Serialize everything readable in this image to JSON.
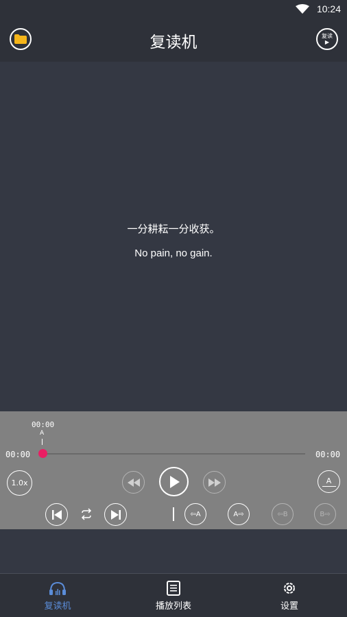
{
  "status": {
    "time": "10:24"
  },
  "header": {
    "title": "复读机",
    "repeat_play_label": "复读",
    "repeat_play_symbol": "▶"
  },
  "content": {
    "line1": "一分耕耘一分收获。",
    "line2": "No pain, no gain."
  },
  "player": {
    "marker_time": "00:00",
    "marker_label": "A",
    "current_time": "00:00",
    "total_time": "00:00",
    "progress": 0,
    "speed_label": "1.0x",
    "ab_label": "A",
    "set_a_label": "⇦A",
    "goto_a_label": "A⇨",
    "set_b_label": "⇦B",
    "goto_b_label": "B⇨"
  },
  "nav": {
    "items": [
      {
        "label": "复读机",
        "icon": "headphones-icon",
        "active": true
      },
      {
        "label": "播放列表",
        "icon": "playlist-icon",
        "active": false
      },
      {
        "label": "设置",
        "icon": "gear-icon",
        "active": false
      }
    ]
  },
  "colors": {
    "accent": "#5b8dd9",
    "thumb": "#e91e63",
    "folder": "#f5b51a"
  }
}
